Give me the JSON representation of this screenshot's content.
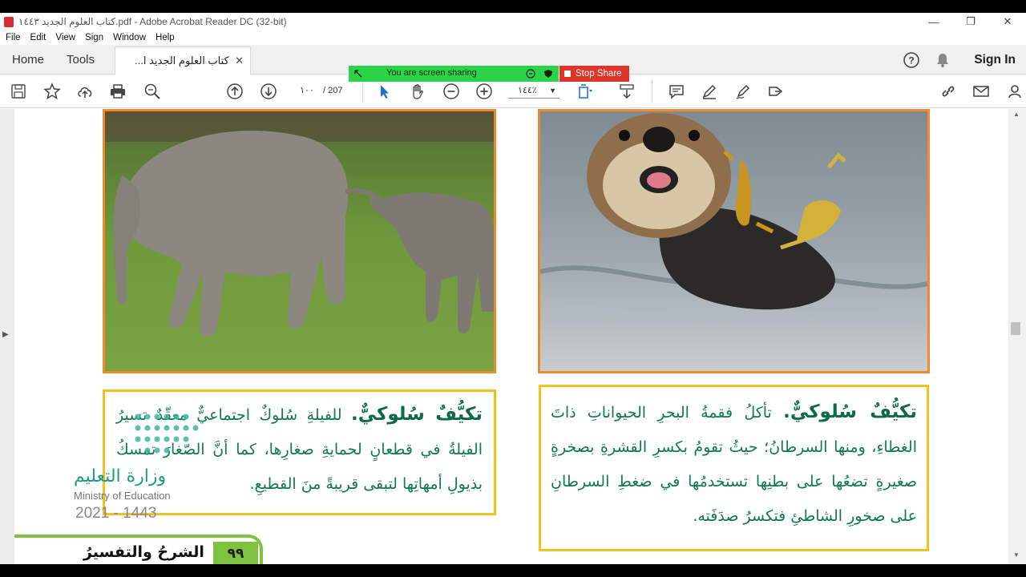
{
  "window": {
    "title": "كتاب العلوم الجديد ١٤٤٣.pdf - Adobe Acrobat Reader DC (32-bit)",
    "minimize": "—",
    "restore": "❐",
    "close": "✕"
  },
  "menu": [
    "File",
    "Edit",
    "View",
    "Sign",
    "Window",
    "Help"
  ],
  "tabs": {
    "home": "Home",
    "tools": "Tools",
    "doc": "كتاب العلوم الجديد ا...",
    "close": "✕"
  },
  "account": {
    "sign_in": "Sign In"
  },
  "share_banner": {
    "text": "You are screen sharing",
    "stop": "Stop Share"
  },
  "toolbar": {
    "page_current": "١٠٠",
    "page_total": "/   207",
    "zoom": "١٤٤٪"
  },
  "doc": {
    "left_box": {
      "heading": "تكيُّفٌ سُلوكيٌّ.",
      "body": " للفيلةِ سُلوكٌ اجتماعيٌّ معقّدٌ تسيرُ الفيلةُ في قطعانٍ لحمايةِ صغارِها، كما أنَّ الصّغارَ تمسكُ بذيولِ أمهاتِها لتبقى قريبةً منَ القطيعِ."
    },
    "right_box": {
      "heading": "تكيُّفٌ سُلوكيٌّ.",
      "body": " تأكلُ فقمةُ البحرِ الحيواناتِ ذاتَ الغطاءِ، ومنها السرطانُ؛ حيثُ تقومُ بكسرِ القشرةِ بصخرةٍ صغيرةٍ تضعُها على بطنِها تستخدمُها في ضغطِ السرطانِ على صخورِ الشاطئِ فتكسرُ صدَفَته."
    },
    "watermark": {
      "arabic": "وزارة التعليم",
      "english": "Ministry of Education",
      "year": "2021 - 1443"
    },
    "footer": {
      "page_number": "٩٩",
      "section": "الشرحُ والتفسيرُ"
    }
  },
  "colors": {
    "photo_border": "#ef8a2e",
    "textbox_border": "#f0c21c",
    "text_green": "#0f7a4e",
    "footer_green": "#7ec242",
    "share_green": "#2bd24a",
    "share_red": "#e0342a"
  }
}
